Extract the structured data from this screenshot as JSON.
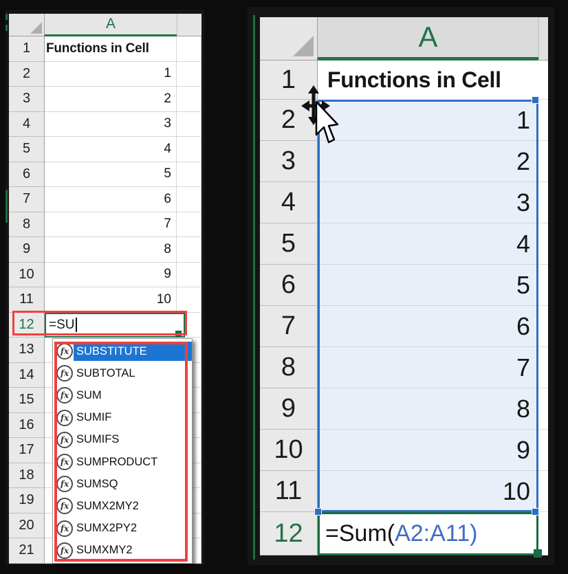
{
  "colors": {
    "excel_green": "#217346",
    "annotation_red": "#ee4140",
    "autocomplete_highlight_blue": "#1d75d3",
    "range_reference_blue": "#3f6dc6",
    "selection_border_blue": "#2d6fc1",
    "selection_fill": "#e9eff9",
    "header_gray": "#e6e6e6"
  },
  "left_sheet": {
    "col_header": "A",
    "rows": [
      {
        "n": "1",
        "v": "Functions in Cell",
        "bold": true
      },
      {
        "n": "2",
        "v": "1"
      },
      {
        "n": "3",
        "v": "2"
      },
      {
        "n": "4",
        "v": "3"
      },
      {
        "n": "5",
        "v": "4"
      },
      {
        "n": "6",
        "v": "5"
      },
      {
        "n": "7",
        "v": "6"
      },
      {
        "n": "8",
        "v": "7"
      },
      {
        "n": "9",
        "v": "8"
      },
      {
        "n": "10",
        "v": "9"
      },
      {
        "n": "11",
        "v": "10"
      },
      {
        "n": "12",
        "v": "=SU",
        "editing": true
      },
      {
        "n": "13",
        "v": ""
      },
      {
        "n": "14",
        "v": ""
      },
      {
        "n": "15",
        "v": ""
      },
      {
        "n": "16",
        "v": ""
      },
      {
        "n": "17",
        "v": ""
      },
      {
        "n": "18",
        "v": ""
      },
      {
        "n": "19",
        "v": ""
      },
      {
        "n": "20",
        "v": ""
      },
      {
        "n": "21",
        "v": ""
      }
    ],
    "autocomplete": {
      "icon_label": "fx",
      "selected": "SUBSTITUTE",
      "items": [
        "SUBSTITUTE",
        "SUBTOTAL",
        "SUM",
        "SUMIF",
        "SUMIFS",
        "SUMPRODUCT",
        "SUMSQ",
        "SUMX2MY2",
        "SUMX2PY2",
        "SUMXMY2"
      ]
    }
  },
  "right_sheet": {
    "col_header": "A",
    "selection_range": "A2:A11",
    "rows": [
      {
        "n": "1",
        "v": "Functions in Cell",
        "bold": true
      },
      {
        "n": "2",
        "v": "1",
        "selected": true
      },
      {
        "n": "3",
        "v": "2",
        "selected": true
      },
      {
        "n": "4",
        "v": "3",
        "selected": true
      },
      {
        "n": "5",
        "v": "4",
        "selected": true
      },
      {
        "n": "6",
        "v": "5",
        "selected": true
      },
      {
        "n": "7",
        "v": "6",
        "selected": true
      },
      {
        "n": "8",
        "v": "7",
        "selected": true
      },
      {
        "n": "9",
        "v": "8",
        "selected": true
      },
      {
        "n": "10",
        "v": "9",
        "selected": true
      },
      {
        "n": "11",
        "v": "10",
        "selected": true
      },
      {
        "n": "12",
        "v": "",
        "editing": true
      }
    ],
    "formula": {
      "prefix": "=Sum(",
      "range": "A2:A11",
      "suffix": ")"
    }
  }
}
